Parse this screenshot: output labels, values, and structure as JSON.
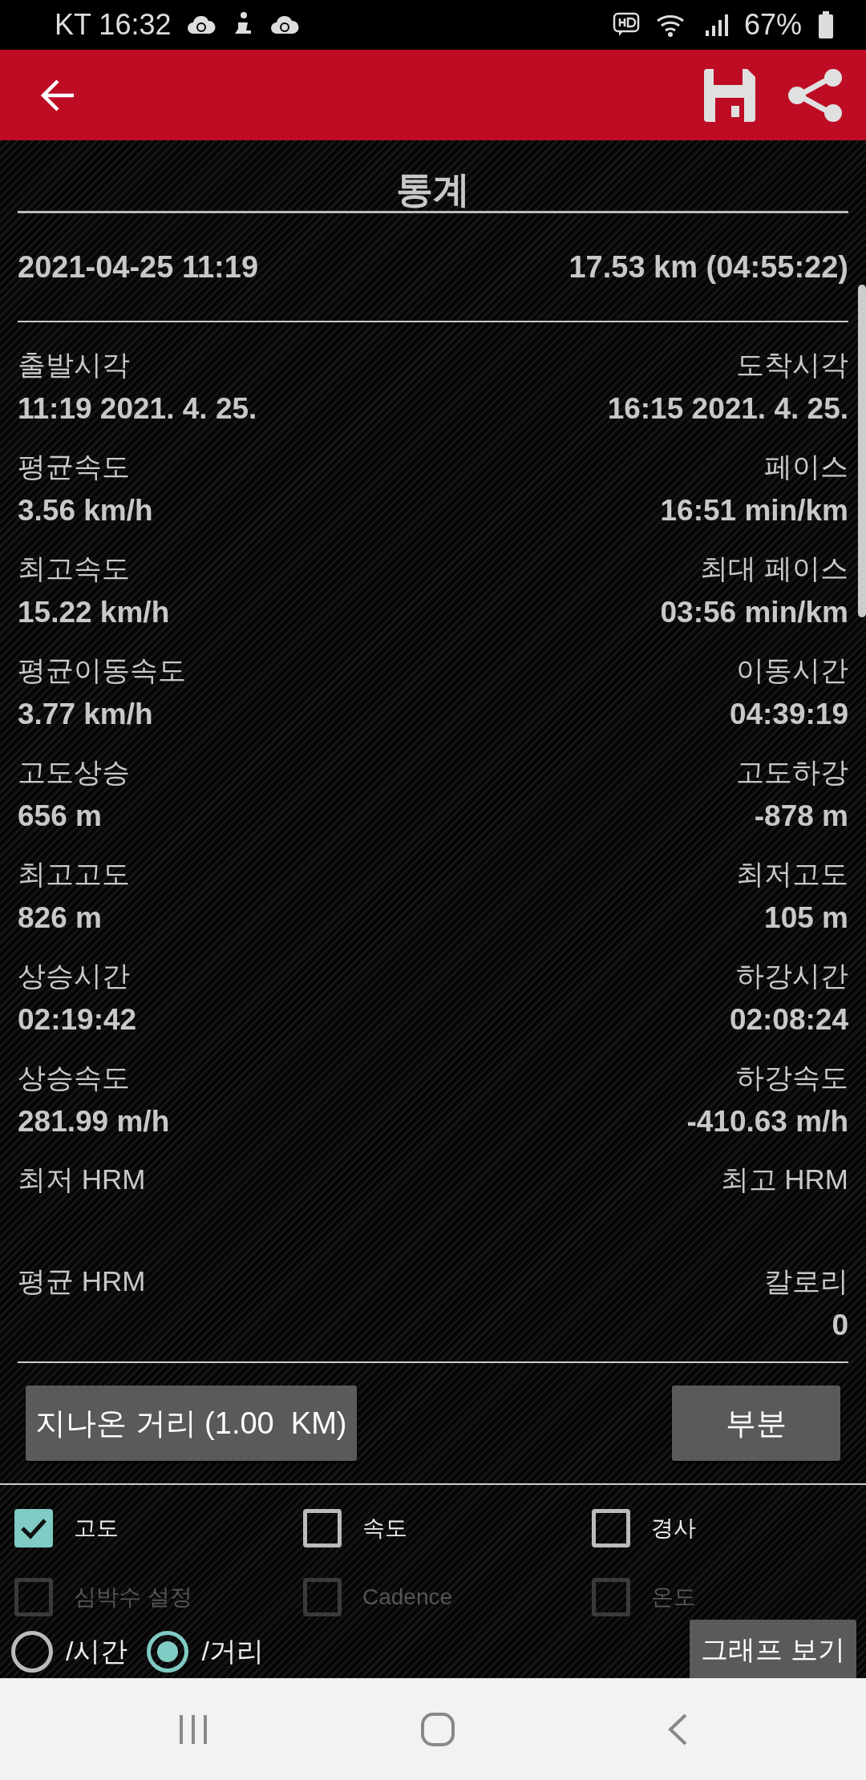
{
  "status_bar": {
    "carrier_time": "KT 16:32",
    "battery": "67%"
  },
  "title": "통계",
  "summary": {
    "date": "2021-04-25 11:19",
    "distance": "17.53 km (04:55:22)"
  },
  "stats": [
    {
      "left": {
        "label": "출발시각",
        "value": "11:19 2021. 4. 25."
      },
      "right": {
        "label": "도착시각",
        "value": "16:15 2021. 4. 25."
      }
    },
    {
      "left": {
        "label": "평균속도",
        "value": "3.56 km/h"
      },
      "right": {
        "label": "페이스",
        "value": "16:51 min/km"
      }
    },
    {
      "left": {
        "label": "최고속도",
        "value": "15.22 km/h"
      },
      "right": {
        "label": "최대 페이스",
        "value": "03:56 min/km"
      }
    },
    {
      "left": {
        "label": "평균이동속도",
        "value": "3.77 km/h"
      },
      "right": {
        "label": "이동시간",
        "value": "04:39:19"
      }
    },
    {
      "left": {
        "label": "고도상승",
        "value": "656 m"
      },
      "right": {
        "label": "고도하강",
        "value": "-878 m"
      }
    },
    {
      "left": {
        "label": "최고고도",
        "value": "826 m"
      },
      "right": {
        "label": "최저고도",
        "value": "105 m"
      }
    },
    {
      "left": {
        "label": "상승시간",
        "value": "02:19:42"
      },
      "right": {
        "label": "하강시간",
        "value": "02:08:24"
      }
    },
    {
      "left": {
        "label": "상승속도",
        "value": "281.99 m/h"
      },
      "right": {
        "label": "하강속도",
        "value": "-410.63 m/h"
      }
    },
    {
      "left": {
        "label": "최저 HRM"
      },
      "right": {
        "label": "최고 HRM"
      }
    },
    {
      "left": {
        "label": "평균 HRM"
      },
      "right": {
        "label": "칼로리",
        "value": "0"
      }
    }
  ],
  "buttons": {
    "distance": "지나온 거리 (1.00  KM)",
    "segment": "부분"
  },
  "options": [
    {
      "label": "고도",
      "checked": true,
      "disabled": false
    },
    {
      "label": "속도",
      "checked": false,
      "disabled": false
    },
    {
      "label": "경사",
      "checked": false,
      "disabled": false
    },
    {
      "label": "심박수 설정",
      "checked": false,
      "disabled": true
    },
    {
      "label": "Cadence",
      "checked": false,
      "disabled": true
    },
    {
      "label": "온도",
      "checked": false,
      "disabled": true
    }
  ],
  "axis": [
    {
      "label": "/시간",
      "selected": false
    },
    {
      "label": "/거리",
      "selected": true
    }
  ],
  "graph_button": "그래프 보기"
}
